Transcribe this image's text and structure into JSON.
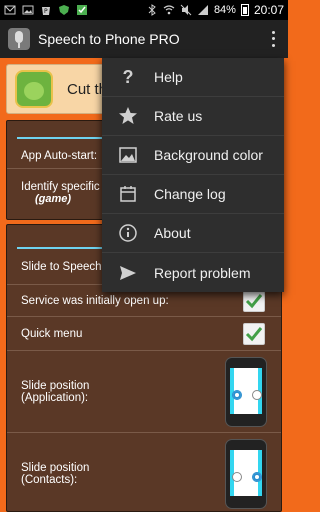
{
  "status_bar": {
    "battery_percent": "84%",
    "time": "20:07"
  },
  "action_bar": {
    "title": "Speech to Phone PRO"
  },
  "promo": {
    "text": "Cut th"
  },
  "settings": {
    "app_autostart_label": "App Auto-start:",
    "identify_label": "Identify specific",
    "identify_value": "(game)",
    "slide_label": "Slide to Speech",
    "service_label": "Service was initially open up:",
    "service_checked": true,
    "quick_menu_label": "Quick menu",
    "quick_menu_checked": true,
    "slide_app_label_1": "Slide position",
    "slide_app_label_2": "(Application):",
    "slide_contacts_label_1": "Slide position",
    "slide_contacts_label_2": "(Contacts):"
  },
  "menu": {
    "items": [
      {
        "label": "Help",
        "icon": "question-icon"
      },
      {
        "label": "Rate us",
        "icon": "star-icon"
      },
      {
        "label": "Background color",
        "icon": "image-icon"
      },
      {
        "label": "Change log",
        "icon": "calendar-icon"
      },
      {
        "label": "About",
        "icon": "info-icon"
      },
      {
        "label": "Report problem",
        "icon": "send-icon"
      }
    ]
  },
  "colors": {
    "background": "#f26a1b",
    "panel": "#5a3826",
    "accent": "#6fd3ef",
    "check": "#43a047"
  }
}
